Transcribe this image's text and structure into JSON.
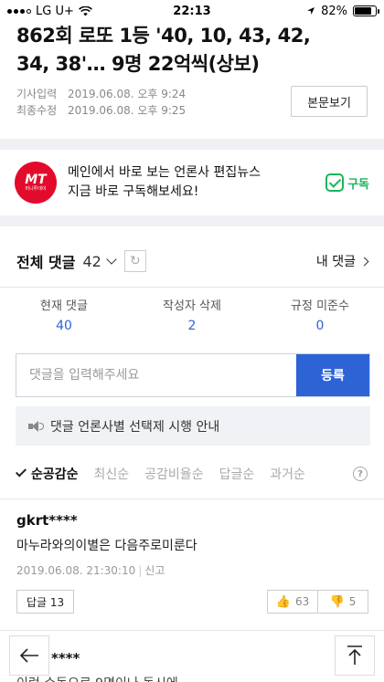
{
  "status_bar": {
    "carrier": "LG U+",
    "time": "22:13",
    "battery": "82%",
    "battery_level": 0.82
  },
  "article": {
    "headline_line1": "862회 로또 1등 '40, 10, 43, 42,",
    "headline_line2": "34, 38'… 9명 22억씩(상보)",
    "input_label": "기사입력",
    "input_date": "2019.06.08. 오후 9:24",
    "modified_label": "최종수정",
    "modified_date": "2019.06.08. 오후 9:25",
    "original_button": "본문보기"
  },
  "promo": {
    "logo_text": "MT",
    "logo_sub": "머니투데이",
    "line1": "메인에서 바로 보는 언론사 편집뉴스",
    "line2": "지금 바로 구독해보세요!",
    "subscribe_label": "구독",
    "accent_color": "#1bb45b",
    "logo_color": "#e30b2b"
  },
  "comments": {
    "title": "전체 댓글",
    "count": "42",
    "my_comments": "내 댓글",
    "stats": [
      {
        "label": "현재 댓글",
        "value": "40"
      },
      {
        "label": "작성자 삭제",
        "value": "2"
      },
      {
        "label": "규정 미준수",
        "value": "0"
      }
    ],
    "input_placeholder": "댓글을 입력해주세요",
    "submit_label": "등록",
    "notice": "댓글 언론사별 선택제 시행 안내",
    "sort_tabs": [
      "순공감순",
      "최신순",
      "공감비율순",
      "답글순",
      "과거순"
    ],
    "accent_color": "#2e63d6"
  },
  "comment1": {
    "user": "gkrt****",
    "body": "마누라와의이별은 다음주로미룬다",
    "date": "2019.06.08. 21:30:10",
    "report": "신고",
    "reply_label": "답글",
    "reply_count": "13",
    "likes": "63",
    "dislikes": "5"
  },
  "comment2": {
    "user_partial": "****",
    "body_partial": "이런 수동으로 9명이나 동시에"
  }
}
